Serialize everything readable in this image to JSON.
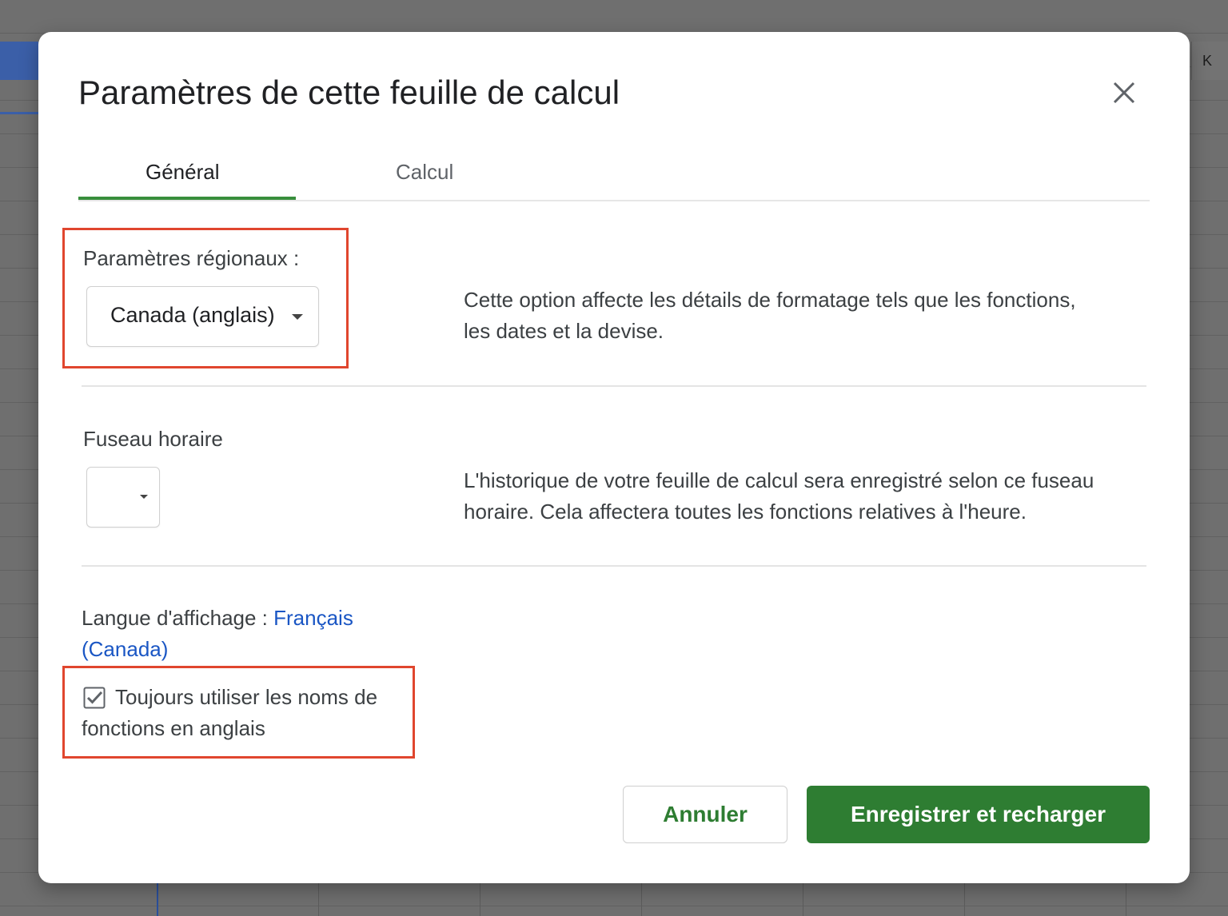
{
  "background": {
    "column_header": "K"
  },
  "dialog": {
    "title": "Paramètres de cette feuille de calcul",
    "close_icon": "close-icon",
    "tabs": [
      {
        "label": "Général",
        "active": true
      },
      {
        "label": "Calcul",
        "active": false
      }
    ],
    "locale": {
      "label": "Paramètres régionaux :",
      "selected": "Canada (anglais)",
      "description_line1": "Cette option affecte les détails de formatage tels que les fonctions,",
      "description_line2": "les dates et la devise."
    },
    "timezone": {
      "label": "Fuseau horaire",
      "selected": "",
      "description_line1": "L'historique de votre feuille de calcul sera enregistré selon ce fuseau",
      "description_line2": "horaire. Cela affectera toutes les fonctions relatives à l'heure."
    },
    "display_language": {
      "label": "Langue d'affichage : ",
      "value_line1": "Français",
      "value_line2": "(Canada)"
    },
    "english_function_names": {
      "checked": true,
      "label_line1": "Toujours utiliser les noms de",
      "label_line2": "fonctions en anglais"
    },
    "buttons": {
      "cancel": "Annuler",
      "save": "Enregistrer et recharger"
    }
  },
  "colors": {
    "accent_green": "#2e7d32",
    "highlight_red": "#e0462e",
    "link_blue": "#1a56c4"
  }
}
